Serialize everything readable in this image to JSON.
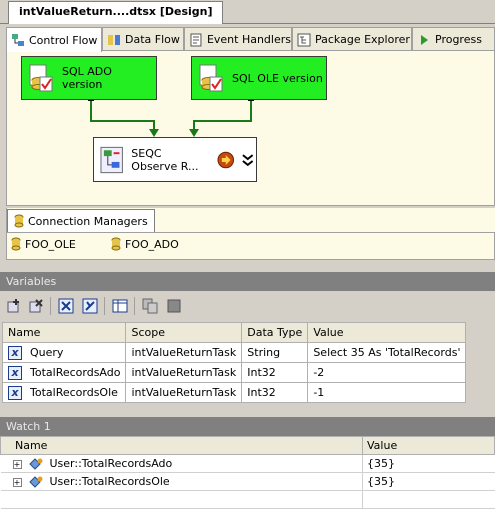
{
  "document_tab": "intValueReturn....dtsx [Design]",
  "designer_tabs": [
    {
      "label": "Control Flow",
      "icon": "control-flow-icon",
      "active": true
    },
    {
      "label": "Data Flow",
      "icon": "data-flow-icon",
      "active": false
    },
    {
      "label": "Event Handlers",
      "icon": "event-handlers-icon",
      "active": false
    },
    {
      "label": "Package Explorer",
      "icon": "package-explorer-icon",
      "active": false
    },
    {
      "label": "Progress",
      "icon": "progress-icon",
      "active": false
    }
  ],
  "tasks": [
    {
      "label": "SQL ADO\nversion",
      "icon": "sql-task-icon",
      "color": "#22ee22"
    },
    {
      "label": "SQL OLE version",
      "icon": "sql-task-icon",
      "color": "#22ee22"
    }
  ],
  "container": {
    "label": "SEQC\nObserve R...",
    "icon": "sequence-container-icon"
  },
  "colors": {
    "connector": "#1a7a1a",
    "canvas": "#fdfbe6",
    "task_fill": "#22ee22"
  },
  "connection_managers": {
    "tab_label": "Connection Managers",
    "items": [
      "FOO_OLE",
      "FOO_ADO"
    ]
  },
  "variables": {
    "title": "Variables",
    "columns": [
      "Name",
      "Scope",
      "Data Type",
      "Value"
    ],
    "rows": [
      {
        "name": "Query",
        "scope": "intValueReturnTask",
        "type": "String",
        "value": "Select 35 As 'TotalRecords'"
      },
      {
        "name": "TotalRecordsAdo",
        "scope": "intValueReturnTask",
        "type": "Int32",
        "value": "-2"
      },
      {
        "name": "TotalRecordsOle",
        "scope": "intValueReturnTask",
        "type": "Int32",
        "value": "-1"
      }
    ]
  },
  "watch": {
    "title": "Watch 1",
    "columns": [
      "Name",
      "Value"
    ],
    "rows": [
      {
        "name": "User::TotalRecordsAdo",
        "value": "{35}"
      },
      {
        "name": "User::TotalRecordsOle",
        "value": "{35}"
      }
    ]
  }
}
